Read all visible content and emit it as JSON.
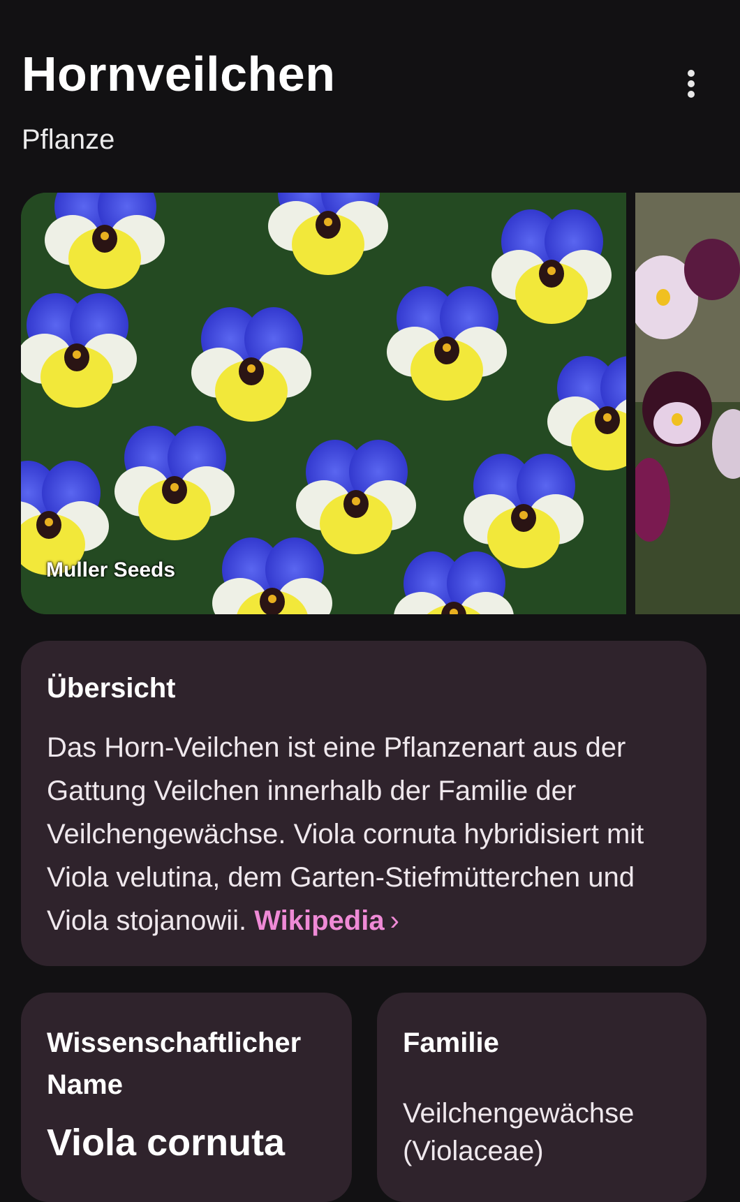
{
  "header": {
    "title": "Hornveilchen",
    "subtitle": "Pflanze",
    "menu_icon": "more-vert-icon"
  },
  "images": {
    "main_caption": "Muller Seeds"
  },
  "overview": {
    "title": "Übersicht",
    "text": "Das Horn-Veilchen ist eine Pflanzenart aus der Gattung Veilchen innerhalb der Familie der Veilchengewächse. Viola cornuta hybridisiert mit Viola velutina, dem Garten-Stiefmütterchen und Viola stojanowii.",
    "link_label": "Wikipedia",
    "link_icon": "chevron-right-icon"
  },
  "facts": {
    "scientific_name_label": "Wissenschaftlicher Name",
    "scientific_name_value": "Viola cornuta",
    "family_label": "Familie",
    "family_value": "Veilchengewächse (Violaceae)"
  },
  "colors": {
    "background": "#121113",
    "card": "#2f232c",
    "link": "#ef8ad6"
  }
}
